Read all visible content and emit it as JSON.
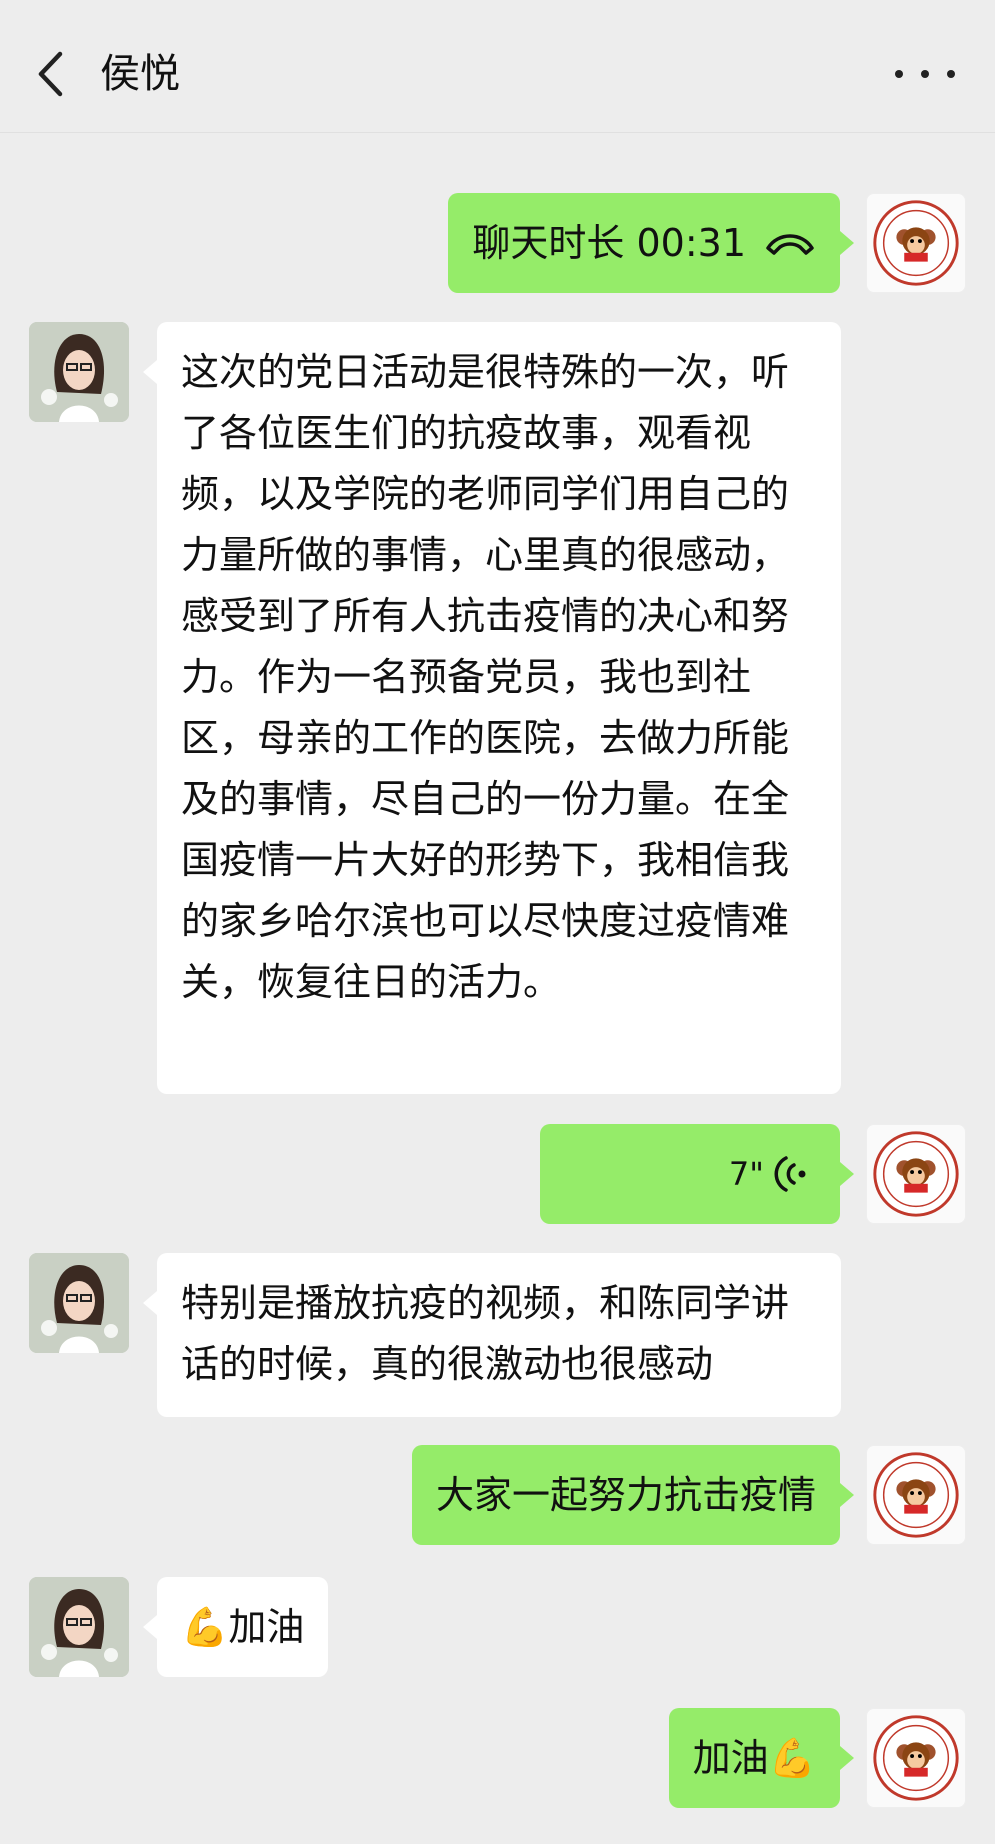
{
  "header": {
    "title": "侯悦"
  },
  "messages": [
    {
      "from": "me",
      "type": "call",
      "text": "聊天时长 00:31",
      "icon": "phone-hangup-icon"
    },
    {
      "from": "contact",
      "type": "text",
      "text": "这次的党日活动是很特殊的一次，听了各位医生们的抗疫故事，观看视频，以及学院的老师同学们用自己的力量所做的事情，心里真的很感动，感受到了所有人抗击疫情的决心和努力。作为一名预备党员，我也到社区，母亲的工作的医院，去做力所能及的事情，尽自己的一份力量。在全国疫情一片大好的形势下，我相信我的家乡哈尔滨也可以尽快度过疫情难关，恢复往日的活力。"
    },
    {
      "from": "me",
      "type": "voice",
      "duration": "7\"",
      "icon": "voice-wave-icon"
    },
    {
      "from": "contact",
      "type": "text",
      "text": "特别是播放抗疫的视频，和陈同学讲话的时候，真的很激动也很感动"
    },
    {
      "from": "me",
      "type": "text",
      "text": "大家一起努力抗击疫情"
    },
    {
      "from": "contact",
      "type": "text",
      "text": "💪加油"
    },
    {
      "from": "me",
      "type": "text",
      "text": "加油💪"
    }
  ],
  "avatars": {
    "contact": {
      "icon": "contact-avatar"
    },
    "me": {
      "icon": "university-logo-avatar"
    }
  }
}
